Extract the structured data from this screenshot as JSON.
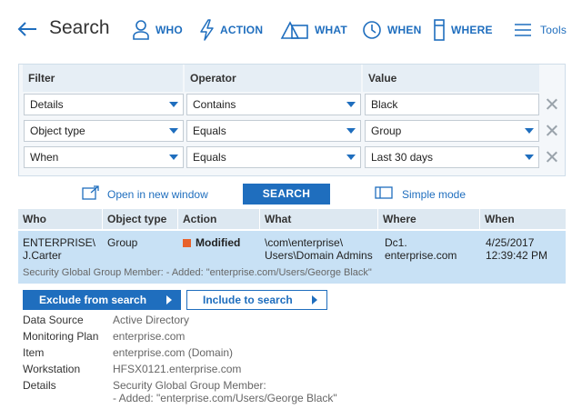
{
  "header": {
    "title": "Search",
    "nav": [
      {
        "label": "WHO",
        "icon": "user-icon"
      },
      {
        "label": "ACTION",
        "icon": "lightning-icon"
      },
      {
        "label": "WHAT",
        "icon": "shapes-icon"
      },
      {
        "label": "WHEN",
        "icon": "clock-icon"
      },
      {
        "label": "WHERE",
        "icon": "server-icon"
      },
      {
        "label": "Tools",
        "icon": "hamburger-icon"
      }
    ]
  },
  "filters": {
    "headers": {
      "filter": "Filter",
      "operator": "Operator",
      "value": "Value"
    },
    "rows": [
      {
        "filter": "Details",
        "operator": "Contains",
        "value": "Black"
      },
      {
        "filter": "Object type",
        "operator": "Equals",
        "value": "Group"
      },
      {
        "filter": "When",
        "operator": "Equals",
        "value": "Last 30 days"
      }
    ]
  },
  "actions": {
    "open_new_window": "Open in new window",
    "search": "SEARCH",
    "simple_mode": "Simple mode"
  },
  "results": {
    "columns": [
      "Who",
      "Object type",
      "Action",
      "What",
      "Where",
      "When"
    ],
    "rows": [
      {
        "who_line1": "ENTERPRISE\\",
        "who_line2": "J.Carter",
        "object_type": "Group",
        "action": "Modified",
        "what_line1": "\\com\\enterprise\\",
        "what_line2": "Users\\Domain Admins",
        "where_line1": "Dc1.",
        "where_line2": "enterprise.com",
        "when_line1": "4/25/2017",
        "when_line2": "12:39:42 PM",
        "detail": "Security Global Group Member: - Added: \"enterprise.com/Users/George Black\""
      }
    ]
  },
  "row_buttons": {
    "exclude": "Exclude from search",
    "include": "Include to search"
  },
  "details": {
    "data_source_label": "Data Source",
    "data_source": "Active Directory",
    "monitoring_plan_label": "Monitoring Plan",
    "monitoring_plan": "enterprise.com",
    "item_label": "Item",
    "item": "enterprise.com (Domain)",
    "workstation_label": "Workstation",
    "workstation": "HFSX0121.enterprise.com",
    "details_label": "Details",
    "details_line1": "Security Global Group Member:",
    "details_line2": "- Added: \"enterprise.com/Users/George Black\""
  },
  "colors": {
    "accent": "#1f6ebe",
    "row_selected": "#c8e1f5",
    "modified": "#e8622c"
  }
}
